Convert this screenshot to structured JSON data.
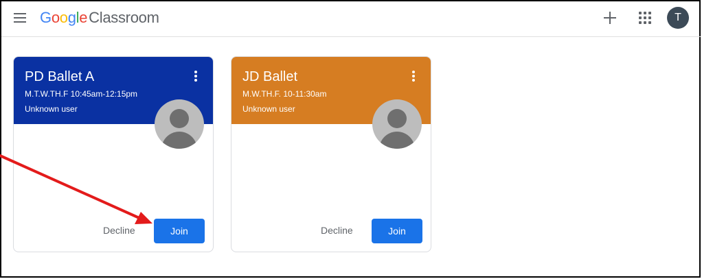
{
  "header": {
    "brand": {
      "google_letters": [
        "G",
        "o",
        "o",
        "g",
        "l",
        "e"
      ],
      "product": "Classroom"
    },
    "icons": [
      "menu-icon",
      "plus-icon",
      "apps-icon"
    ],
    "account_initial": "T"
  },
  "classes": [
    {
      "title": "PD Ballet A",
      "schedule": "M.T.W.TH.F 10:45am-12:15pm",
      "owner": "Unknown user",
      "color": "#0a31a2",
      "decline_label": "Decline",
      "join_label": "Join"
    },
    {
      "title": "JD Ballet",
      "schedule": "M.W.TH.F. 10-11:30am",
      "owner": "Unknown user",
      "color": "#d67d22",
      "decline_label": "Decline",
      "join_label": "Join"
    }
  ],
  "colors": {
    "join_button": "#1a73e8",
    "annotation_arrow": "#e31b1b"
  }
}
